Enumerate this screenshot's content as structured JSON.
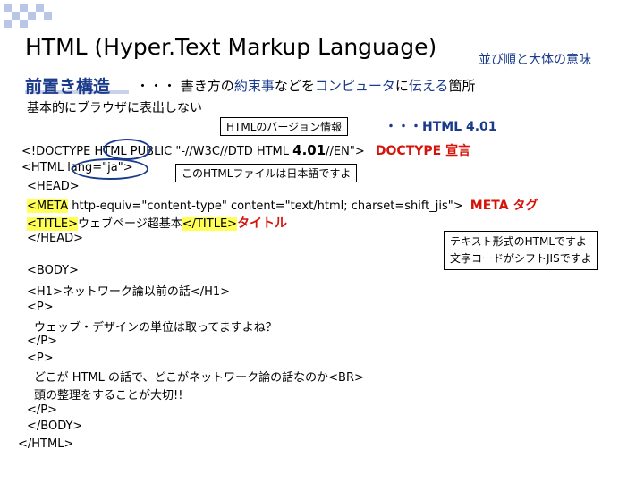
{
  "slide": {
    "title": "HTML (Hyper.Text Markup Language)",
    "subtitle_right": "並び順と大体の意味",
    "pre_heading": "前置き構造",
    "pre_desc_dots": "・・・",
    "pre_desc_1": "書き方の",
    "pre_desc_2": "約束事",
    "pre_desc_3": "などを",
    "pre_desc_4": "コンピュータ",
    "pre_desc_5": "に",
    "pre_desc_6": "伝える",
    "pre_desc_7": "箇所",
    "basic_note": "基本的にブラウザに表出しない"
  },
  "callouts": {
    "version_box": "HTMLのバージョン情報",
    "version_label": "・・・HTML 4.01",
    "japanese_box": "このHTMLファイルは日本語ですよ",
    "text_format_1": "テキスト形式のHTMLですよ",
    "text_format_2": "文字コードがシフトJISですよ"
  },
  "code": {
    "doctype_a": "<!DOCTYPE HTML PUBLIC \"-//W3C//DTD HTML ",
    "doctype_ver": "4.01",
    "doctype_b": "//EN\">",
    "doctype_label": "DOCTYPE 宣言",
    "html_open": "<HTML lang=\"ja\">",
    "head_open": "<HEAD>",
    "meta_tag": "<META",
    "meta_rest": " http-equiv=\"content-type\" content=\"text/html; charset=shift_jis\">",
    "meta_label": "META タグ",
    "title_open": "<TITLE>",
    "title_text": "ウェブページ超基本",
    "title_close": "</TITLE>",
    "title_label": "タイトル",
    "head_close": "</HEAD>",
    "body_open": "<BODY>",
    "h1_line": "<H1>ネットワーク論以前の話</H1>",
    "p_open_1": "<P>",
    "p_text_1": "ウェッブ・デザインの単位は取ってますよね？",
    "p_close_1": "</P>",
    "p_open_2": "<P>",
    "p_text_2a": "どこが HTML の話で、どこがネットワーク論の話なのか<BR>",
    "p_text_2b": "頭の整理をすることが大切!!",
    "p_close_2": "</P>",
    "body_close": "</BODY>",
    "html_close": "</HTML>"
  }
}
